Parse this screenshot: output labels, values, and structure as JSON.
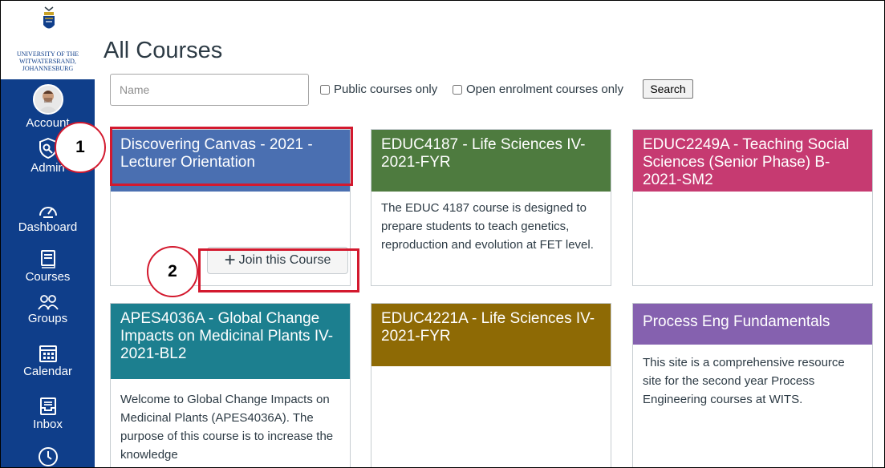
{
  "sidebar": {
    "logo_lines": [
      "UNIVERSITY OF THE",
      "WITWATERSRAND,",
      "JOHANNESBURG"
    ],
    "items": [
      {
        "label": "Account",
        "icon": "avatar"
      },
      {
        "label": "Admin",
        "icon": "shield-icon"
      },
      {
        "label": "Dashboard",
        "icon": "speedometer-icon"
      },
      {
        "label": "Courses",
        "icon": "book-icon"
      },
      {
        "label": "Groups",
        "icon": "people-icon"
      },
      {
        "label": "Calendar",
        "icon": "calendar-icon"
      },
      {
        "label": "Inbox",
        "icon": "inbox-icon"
      },
      {
        "label": "",
        "icon": "clock-icon"
      }
    ]
  },
  "page": {
    "title": "All Courses"
  },
  "search": {
    "placeholder": "Name",
    "public_label": "Public courses only",
    "open_label": "Open enrolment courses only",
    "button_label": "Search"
  },
  "courses": [
    {
      "title": "Discovering Canvas - 2021 - Lecturer Orientation",
      "color": "#4a6fb1",
      "description": "",
      "join_label": "Join this Course"
    },
    {
      "title": "EDUC4187 - Life Sciences IV-2021-FYR",
      "color": "#4e7b3f",
      "description": "The EDUC 4187 course is designed to prepare students to teach genetics, reproduction and evolution at FET level."
    },
    {
      "title": "EDUC2249A - Teaching Social Sciences (Senior Phase) B-2021-SM2",
      "color": "#c63a71",
      "description": ""
    },
    {
      "title": "APES4036A - Global Change Impacts on Medicinal Plants IV-2021-BL2",
      "color": "#1c7f8f",
      "description": "Welcome to Global Change Impacts on Medicinal Plants (APES4036A). The purpose of this course is to increase the knowledge"
    },
    {
      "title": "EDUC4221A - Life Sciences IV-2021-FYR",
      "color": "#8e6a05",
      "description": ""
    },
    {
      "title": "Process Eng Fundamentals",
      "color": "#8561af",
      "description": "This site is a comprehensive resource site for the second year Process Engineering courses at WITS."
    }
  ],
  "callouts": [
    "1",
    "2"
  ],
  "colors": {
    "nav": "#0f3e8a",
    "highlight": "#d3192e"
  }
}
